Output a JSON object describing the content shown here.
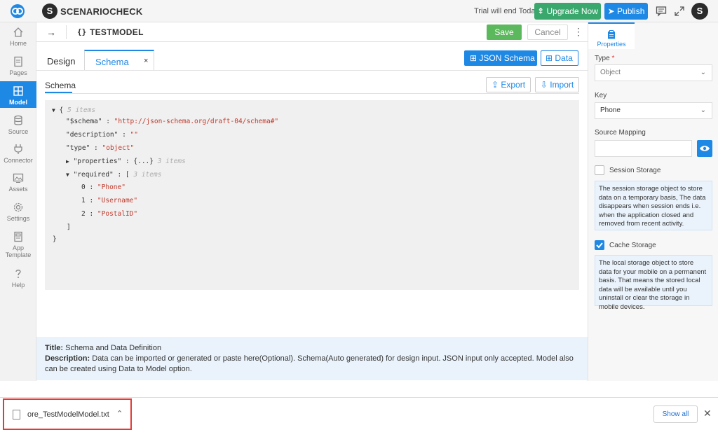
{
  "header": {
    "brand_initial": "S",
    "brand_name": "SCENARIOCHECK",
    "trial_text": "Trial will end Today",
    "upgrade_label": "Upgrade Now",
    "publish_label": "Publish",
    "user_initial": "S"
  },
  "sidebar": {
    "items": [
      {
        "label": "Home",
        "icon": "home-icon"
      },
      {
        "label": "Pages",
        "icon": "pages-icon"
      },
      {
        "label": "Model",
        "icon": "model-icon"
      },
      {
        "label": "Source",
        "icon": "database-icon"
      },
      {
        "label": "Connector",
        "icon": "plug-icon"
      },
      {
        "label": "Assets",
        "icon": "image-icon"
      },
      {
        "label": "Settings",
        "icon": "gear-icon"
      },
      {
        "label": "App",
        "label2": "Template",
        "icon": "template-icon"
      },
      {
        "label": "Help",
        "icon": "help-icon"
      }
    ],
    "active": "Model"
  },
  "editor": {
    "back": "→",
    "model_icon": "{}",
    "model_name": "TESTMODEL",
    "save_label": "Save",
    "cancel_label": "Cancel",
    "more": "⋮"
  },
  "tabs": {
    "design": "Design",
    "schema": "Schema",
    "close": "×",
    "json_schema_label": "JSON Schema",
    "data_label": "Data"
  },
  "schema_section": {
    "title": "Schema",
    "export_label": "Export",
    "import_label": "Import"
  },
  "schema": {
    "root_comment": "5 items",
    "schema_key": "\"$schema\"",
    "schema_value": "\"http://json-schema.org/draft-04/schema#\"",
    "description_key": "\"description\"",
    "description_value": "\"\"",
    "type_key": "\"type\"",
    "type_value": "\"object\"",
    "properties_key": "\"properties\"",
    "properties_collapsed": "{...}",
    "properties_comment": "3 items",
    "required_key": "\"required\"",
    "required_comment": "3 items",
    "required_items": [
      {
        "index": "0",
        "value": "\"Phone\""
      },
      {
        "index": "1",
        "value": "\"Username\""
      },
      {
        "index": "2",
        "value": "\"PostalID\""
      }
    ]
  },
  "info": {
    "title_label": "Title:",
    "title_text": "Schema and Data Definition",
    "description_label": "Description:",
    "description_text": "Data can be imported or generated or paste here(Optional). Schema(Auto generated) for design input. JSON input only accepted. Model also can be created using Data to Model option."
  },
  "properties": {
    "tab_label": "Properties",
    "type_label": "Type",
    "required_mark": "*",
    "type_value": "Object",
    "key_label": "Key",
    "key_value": "Phone",
    "source_mapping_label": "Source Mapping",
    "source_mapping_value": "",
    "session_storage_label": "Session Storage",
    "session_storage_checked": false,
    "session_storage_help": "The session storage object to store data on a temporary basis, The data disappears when session ends i.e. when the application closed and removed from recent activity.",
    "cache_storage_label": "Cache Storage",
    "cache_storage_checked": true,
    "cache_storage_help": "The local storage object to store data for your mobile on a permanent basis. That means the stored local data will be available until you uninstall or clear the storage in mobile devices."
  },
  "download": {
    "file_name": "ore_TestModelModel.txt",
    "show_all_label": "Show all",
    "close": "✕"
  },
  "colors": {
    "accent": "#1e88e5",
    "upgrade": "#3aa76d",
    "save": "#5cb85c",
    "highlight_border": "#e53935"
  }
}
